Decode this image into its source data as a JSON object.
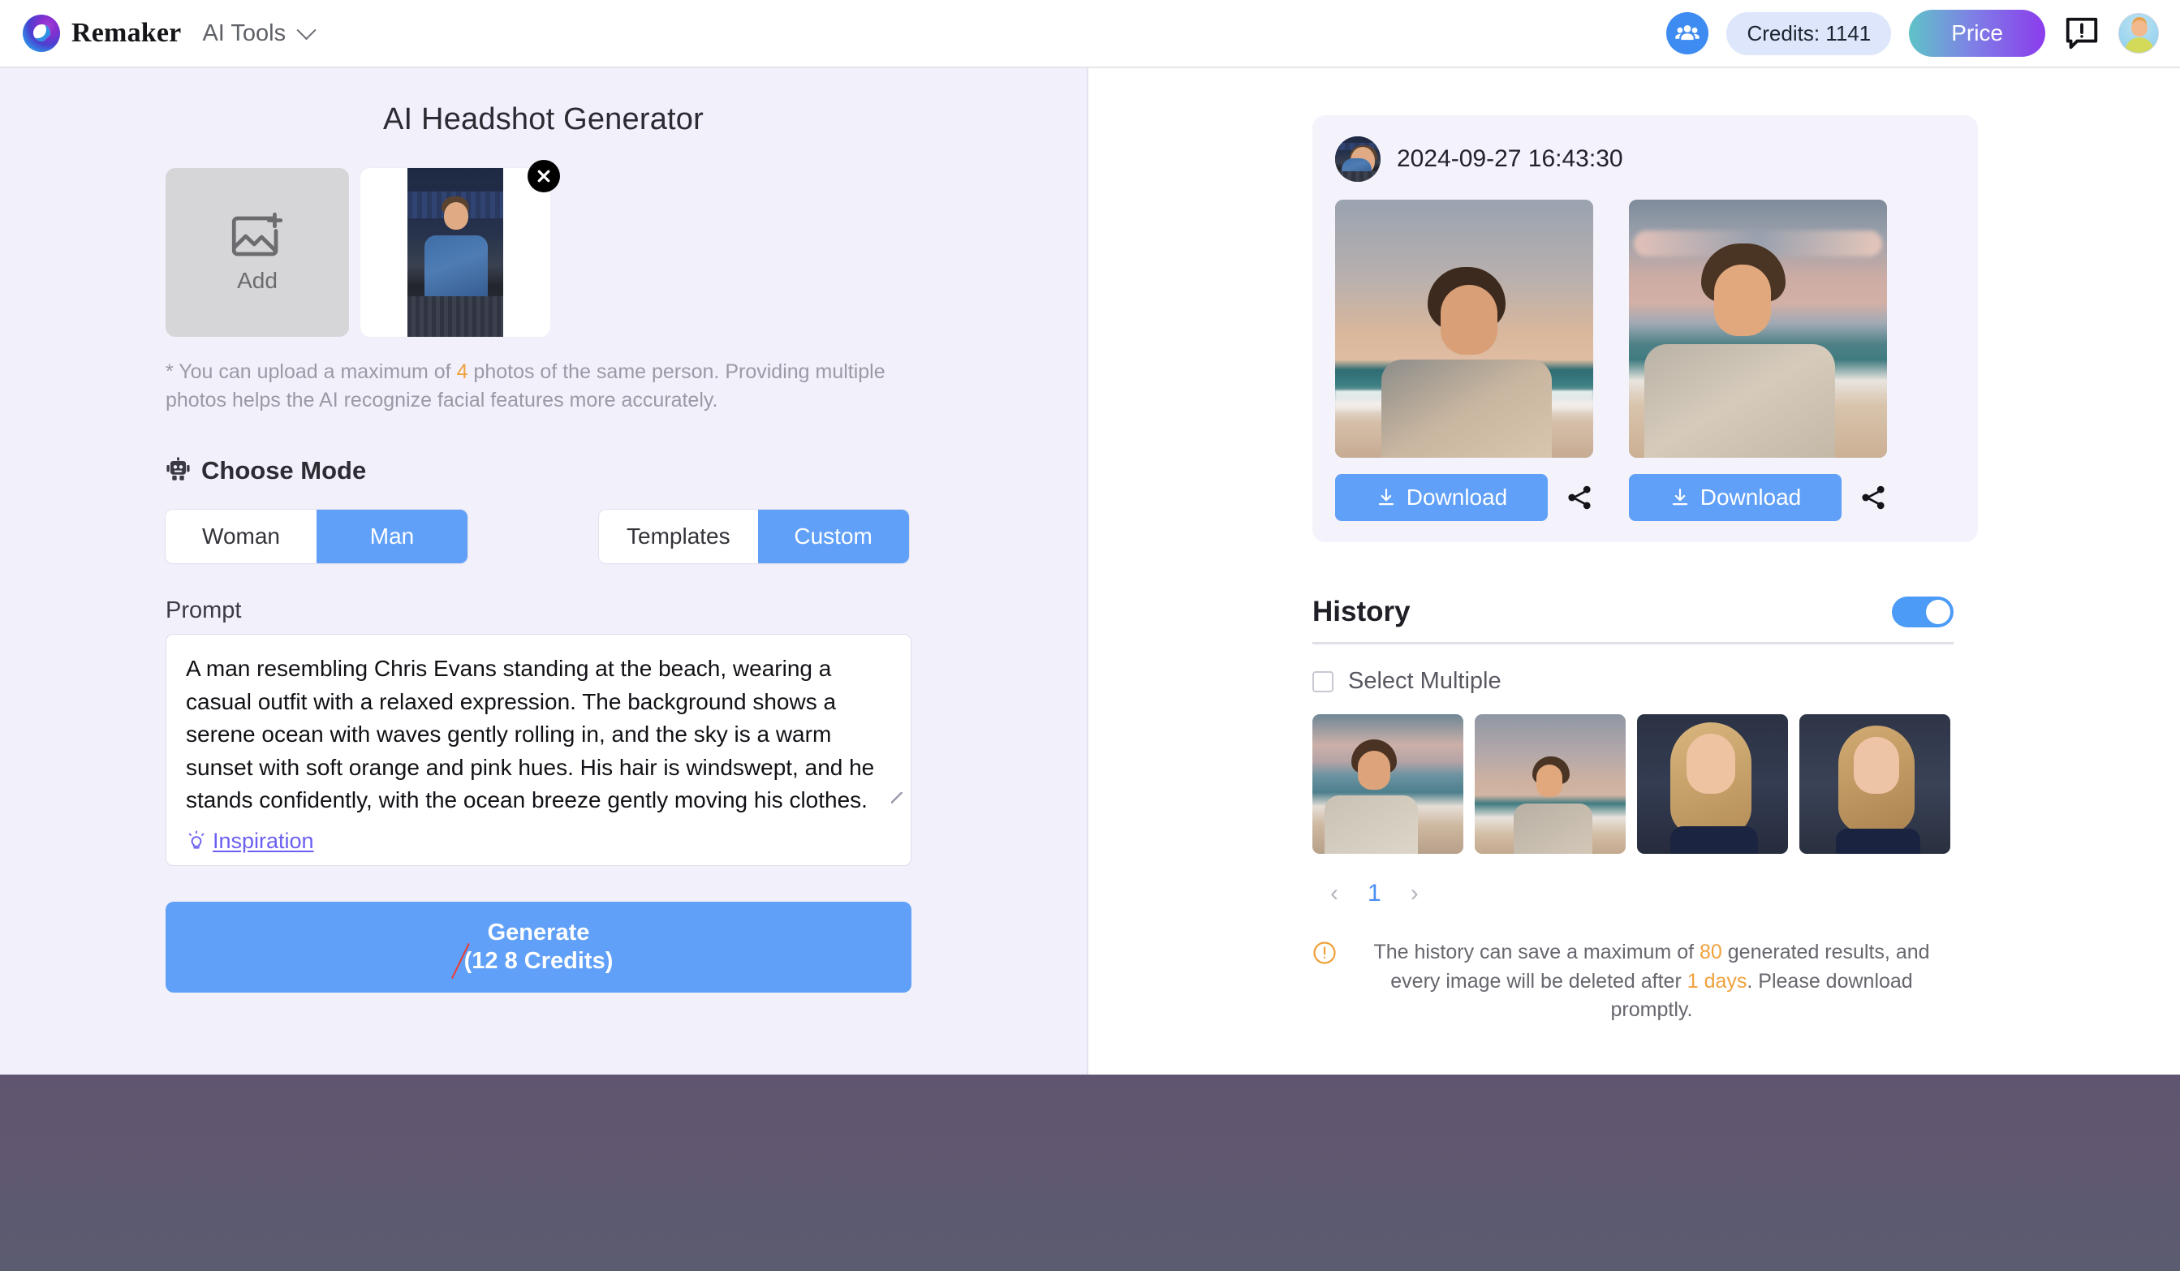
{
  "header": {
    "brand_name": "Remaker",
    "nav_label": "AI Tools",
    "credits_label": "Credits: 1141",
    "price_label": "Price",
    "icons": {
      "logo": "remaker-logo",
      "chevron": "chevron-down-icon",
      "team": "team-icon",
      "feedback": "feedback-icon",
      "avatar": "user-avatar"
    }
  },
  "left": {
    "title": "AI Headshot Generator",
    "add_label": "Add",
    "upload_note_pre": "* You can upload a maximum of ",
    "upload_note_max": "4",
    "upload_note_post": " photos of the same person. Providing multiple photos helps the AI recognize facial features more accurately.",
    "mode_title": "Choose Mode",
    "gender": {
      "options": [
        "Woman",
        "Man"
      ],
      "selected": "Man"
    },
    "style": {
      "options": [
        "Templates",
        "Custom"
      ],
      "selected": "Custom"
    },
    "prompt_label": "Prompt",
    "prompt_value": "A man resembling Chris Evans standing at the beach, wearing a casual outfit with a relaxed expression. The background shows a serene ocean with waves gently rolling in, and the sky is a warm sunset with soft orange and pink hues. His hair is windswept, and he stands confidently, with the ocean breeze gently moving his clothes.",
    "inspiration_label": "Inspiration",
    "generate_main": "Generate",
    "generate_paren_open": "(",
    "generate_old_price": "12",
    "generate_new_price": " 8 Credits",
    "generate_paren_close": ")"
  },
  "right": {
    "result_timestamp": "2024-09-27 16:43:30",
    "download_label": "Download",
    "results": [
      {
        "alt": "generated-headshot-1"
      },
      {
        "alt": "generated-headshot-2"
      }
    ],
    "history_title": "History",
    "history_toggle_on": true,
    "select_multiple_label": "Select Multiple",
    "history_items": [
      {
        "alt": "history-thumb-1"
      },
      {
        "alt": "history-thumb-2"
      },
      {
        "alt": "history-thumb-3"
      },
      {
        "alt": "history-thumb-4"
      }
    ],
    "pager": {
      "prev": "‹",
      "page": "1",
      "next": "›"
    },
    "note_pre": "The history can save a maximum of ",
    "note_max": "80",
    "note_mid": " generated results, and every image will be deleted after ",
    "note_days": "1 days",
    "note_post": ". Please download promptly."
  },
  "colors": {
    "accent_blue": "#60a0f8",
    "link_purple": "#6a5ff0",
    "highlight_orange": "#f0a13c",
    "left_bg": "#f2f0fb",
    "card_bg": "#f4f2fb",
    "strike_red": "#ee3b2f"
  }
}
